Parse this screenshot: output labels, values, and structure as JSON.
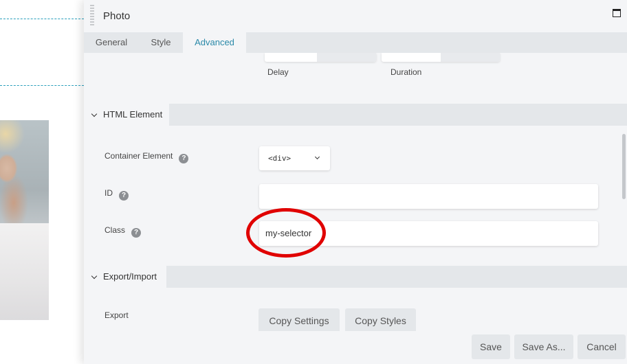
{
  "panel": {
    "title": "Photo"
  },
  "tabs": [
    {
      "label": "General"
    },
    {
      "label": "Style"
    },
    {
      "label": "Advanced",
      "active": true
    }
  ],
  "animation": {
    "delay_label": "Delay",
    "duration_label": "Duration"
  },
  "html_element": {
    "section_title": "HTML Element",
    "container_label": "Container Element",
    "container_value": "<div>",
    "id_label": "ID",
    "id_value": "",
    "class_label": "Class",
    "class_value": "my-selector",
    "help_glyph": "?"
  },
  "export_import": {
    "section_title": "Export/Import",
    "export_label": "Export",
    "copy_settings": "Copy Settings",
    "copy_styles": "Copy Styles"
  },
  "footer": {
    "save": "Save",
    "save_as": "Save As...",
    "cancel": "Cancel"
  },
  "colors": {
    "accent": "#2a89a8",
    "highlight_circle": "#e00000",
    "guide_line": "#2a9fbc"
  },
  "icons": {
    "drag": "drag-handle-icon",
    "maximize": "maximize-icon",
    "collapse": "chevron-down-icon",
    "help": "help-icon",
    "select": "chevron-down-icon"
  }
}
